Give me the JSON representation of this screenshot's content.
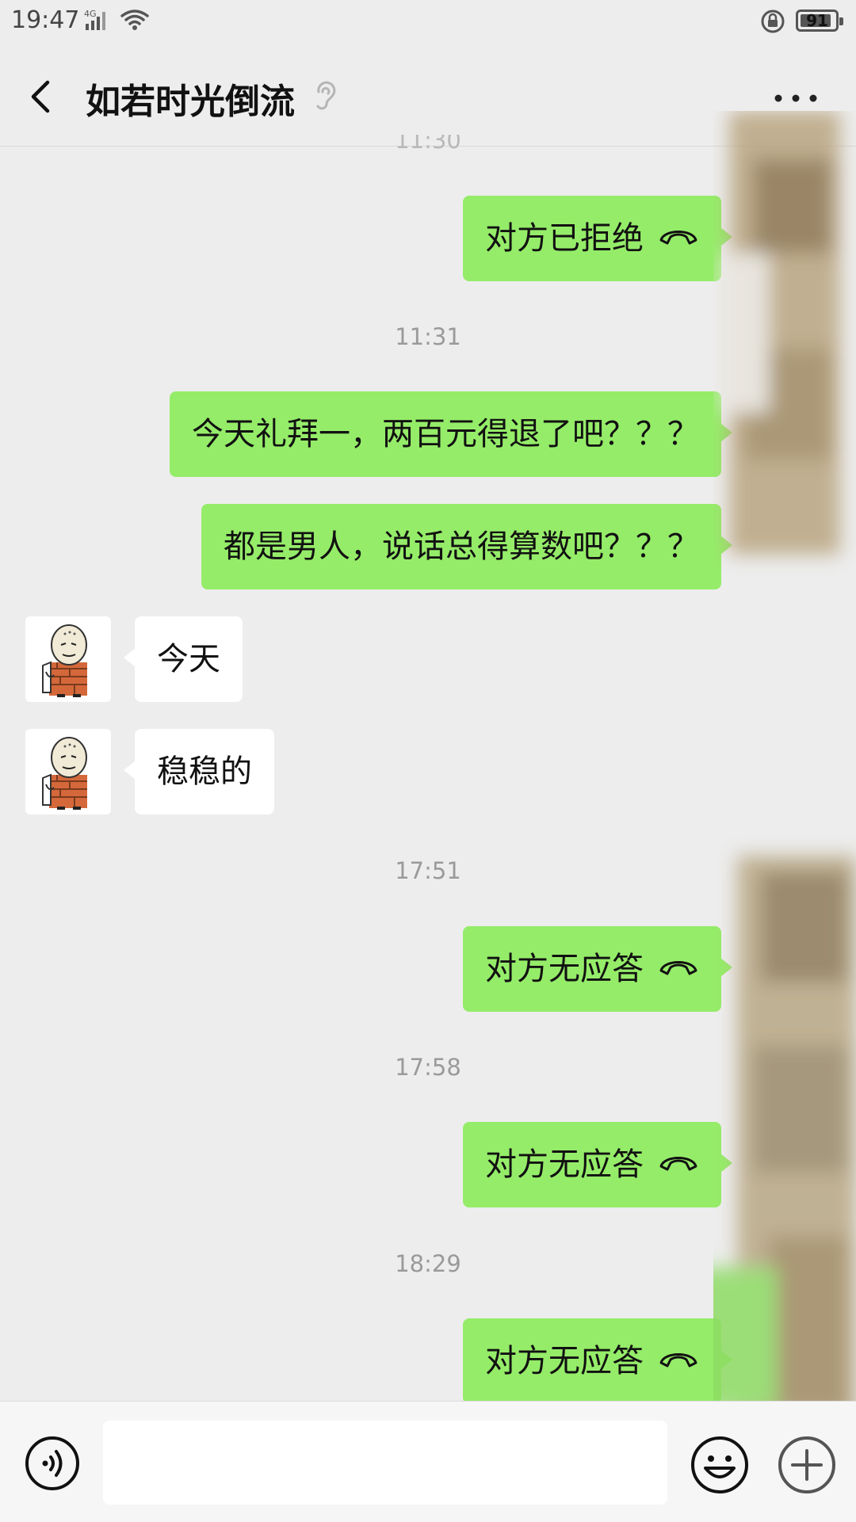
{
  "status_bar": {
    "time": "19:47",
    "network": "4G",
    "battery": "91",
    "battery_fill": 0.91
  },
  "header": {
    "title": "如若时光倒流",
    "back_icon": "chevron-left-icon",
    "more_icon": "more-dots-icon",
    "mute_icon": "ear-icon"
  },
  "messages": [
    {
      "type": "call",
      "side": "out",
      "text": "对方已拒绝",
      "icon": "phone-hangup-icon"
    },
    {
      "type": "timestamp",
      "text": "11:31"
    },
    {
      "type": "text",
      "side": "out",
      "text": "今天礼拜一，两百元得退了吧？？？"
    },
    {
      "type": "text",
      "side": "out",
      "text": "都是男人，说话总得算数吧？？？"
    },
    {
      "type": "text",
      "side": "in",
      "text": "今天"
    },
    {
      "type": "text",
      "side": "in",
      "text": "稳稳的"
    },
    {
      "type": "timestamp",
      "text": "17:51"
    },
    {
      "type": "call",
      "side": "out",
      "text": "对方无应答",
      "icon": "phone-hangup-icon"
    },
    {
      "type": "timestamp",
      "text": "17:58"
    },
    {
      "type": "call",
      "side": "out",
      "text": "对方无应答",
      "icon": "phone-hangup-icon"
    },
    {
      "type": "timestamp",
      "text": "18:29"
    },
    {
      "type": "call",
      "side": "out",
      "text": "对方无应答",
      "icon": "phone-hangup-icon"
    }
  ],
  "input_bar": {
    "placeholder": "",
    "voice_icon": "voice-icon",
    "emoji_icon": "emoji-icon",
    "plus_icon": "plus-icon"
  },
  "colors": {
    "background": "#ededed",
    "outgoing_bubble": "#95ec69",
    "incoming_bubble": "#ffffff",
    "timestamp": "#9a9a9a"
  }
}
